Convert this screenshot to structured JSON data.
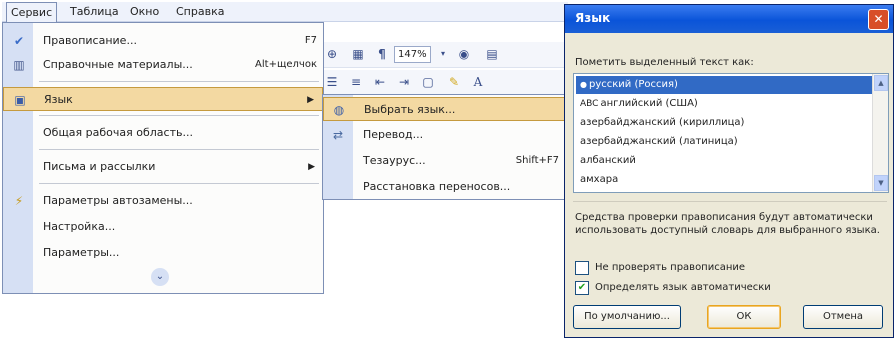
{
  "menubar": {
    "items": [
      {
        "label": "Сервис"
      },
      {
        "label": "Таблица"
      },
      {
        "label": "Окно"
      },
      {
        "label": "Справка"
      }
    ]
  },
  "toolbar": {
    "zoom": "147%",
    "pilcrow": "¶",
    "font_a": "A"
  },
  "main_menu": {
    "items": [
      {
        "label": "Правописание...",
        "shortcut": "F7",
        "icon": "spelling-icon"
      },
      {
        "label": "Справочные материалы...",
        "shortcut": "Alt+щелчок",
        "icon": "book-icon"
      },
      {
        "label": "Язык",
        "icon": "language-icon",
        "submenu": true
      },
      {
        "label": "Общая рабочая область..."
      },
      {
        "label": "Письма и рассылки",
        "submenu": true
      },
      {
        "label": "Параметры автозамены...",
        "icon": "autocorrect-icon"
      },
      {
        "label": "Настройка..."
      },
      {
        "label": "Параметры..."
      }
    ],
    "expand_icon": "double-chevron-down-icon"
  },
  "submenu": {
    "items": [
      {
        "label": "Выбрать язык...",
        "icon": "globe-icon"
      },
      {
        "label": "Перевод...",
        "icon": "translate-icon"
      },
      {
        "label": "Тезаурус...",
        "shortcut": "Shift+F7"
      },
      {
        "label": "Расстановка переносов..."
      }
    ]
  },
  "dialog": {
    "title": "Язык",
    "mark_label": "Пометить выделенный текст как:",
    "languages": [
      {
        "label": "русский (Россия)",
        "selected": true,
        "mark": ""
      },
      {
        "label": "английский (США)",
        "selected": false,
        "mark": "ABC"
      },
      {
        "label": "азербайджанский (кириллица)",
        "selected": false,
        "mark": ""
      },
      {
        "label": "азербайджанский (латиница)",
        "selected": false,
        "mark": ""
      },
      {
        "label": "албанский",
        "selected": false,
        "mark": ""
      },
      {
        "label": "амхара",
        "selected": false,
        "mark": ""
      }
    ],
    "info_text": "Средства проверки правописания будут автоматически использовать доступный словарь для выбранного языка.",
    "check_no_spell": {
      "label": "Не проверять правописание",
      "checked": false
    },
    "check_detect": {
      "label": "Определять язык автоматически",
      "checked": true
    },
    "buttons": {
      "default": "По умолчанию...",
      "ok": "ОК",
      "cancel": "Отмена"
    }
  },
  "colors": {
    "menu_gutter": "#d6e0f4",
    "highlight": "#f3d9a2",
    "selection": "#316ac5",
    "title_bar": "#0a54d9"
  }
}
